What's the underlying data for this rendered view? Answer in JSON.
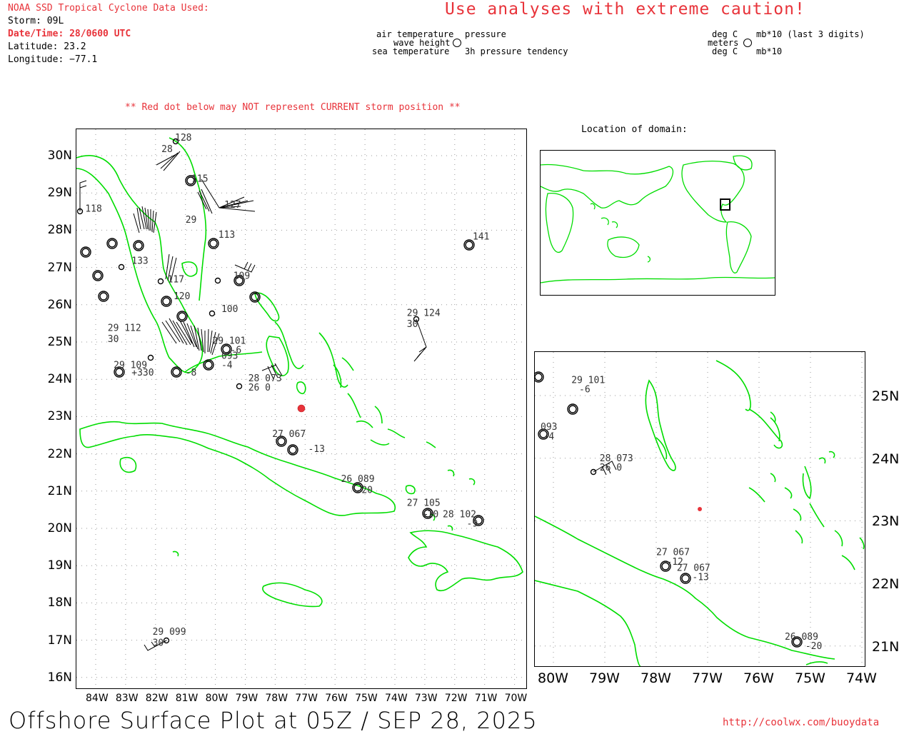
{
  "header": {
    "source": "NOAA SSD Tropical Cyclone Data Used:",
    "storm": "Storm: 09L",
    "datetime": "Date/Time: 28/0600 UTC",
    "latitude": "Latitude: 23.2",
    "longitude": "Longitude: −77.1",
    "caution": "Use analyses with extreme caution!",
    "red_dot_note": "** Red dot below may NOT represent CURRENT storm position **"
  },
  "legend": {
    "air_temp": "air temperature",
    "pressure": "pressure",
    "wave_height": "wave height",
    "sea_temp": "sea temperature",
    "tendency": "3h pressure tendency",
    "unit_degc": "deg C",
    "unit_mb": "mb*10 (last 3 digits)",
    "unit_meters": "meters",
    "unit_degc2": "deg C",
    "unit_mb10": "mb*10"
  },
  "location_label": "Location of domain:",
  "footer": {
    "title": "Offshore Surface Plot at 05Z / SEP 28, 2025",
    "url": "http://coolwx.com/buoydata"
  },
  "colors": {
    "land": "#00dd00",
    "accent": "#e8333a",
    "grid": "#999999"
  },
  "main_map": {
    "lat_labels": [
      "30N",
      "29N",
      "28N",
      "27N",
      "26N",
      "25N",
      "24N",
      "23N",
      "22N",
      "21N",
      "20N",
      "19N",
      "18N",
      "17N",
      "16N"
    ],
    "lon_labels": [
      "84W",
      "83W",
      "82W",
      "81W",
      "80W",
      "79W",
      "78W",
      "77W",
      "76W",
      "75W",
      "74W",
      "73W",
      "72W",
      "71W",
      "70W"
    ],
    "station_labels": [
      {
        "t": "128",
        "lon": -81.35,
        "lat": 30.4
      },
      {
        "t": "28",
        "lon": -81.8,
        "lat": 30.1
      },
      {
        "t": "115",
        "lon": -80.8,
        "lat": 29.3
      },
      {
        "t": "118",
        "lon": -84.35,
        "lat": 28.5
      },
      {
        "t": "127",
        "lon": -79.7,
        "lat": 28.6
      },
      {
        "t": "29",
        "lon": -81.0,
        "lat": 28.2
      },
      {
        "t": "113",
        "lon": -79.9,
        "lat": 27.8
      },
      {
        "t": "133",
        "lon": -82.8,
        "lat": 27.1
      },
      {
        "t": "117",
        "lon": -81.6,
        "lat": 26.6
      },
      {
        "t": "109",
        "lon": -79.4,
        "lat": 26.7
      },
      {
        "t": "120",
        "lon": -81.4,
        "lat": 26.15
      },
      {
        "t": "100",
        "lon": -79.8,
        "lat": 25.8
      },
      {
        "t": "29 124",
        "lon": -73.6,
        "lat": 25.7
      },
      {
        "t": "30",
        "lon": -73.6,
        "lat": 25.4
      },
      {
        "t": "29 112",
        "lon": -83.6,
        "lat": 25.3
      },
      {
        "t": "30",
        "lon": -83.6,
        "lat": 25.0
      },
      {
        "t": "29 101",
        "lon": -80.1,
        "lat": 24.95
      },
      {
        "t": "-6",
        "lon": -79.5,
        "lat": 24.7
      },
      {
        "t": "093",
        "lon": -79.8,
        "lat": 24.55
      },
      {
        "t": "-4",
        "lon": -79.8,
        "lat": 24.3
      },
      {
        "t": "28 073",
        "lon": -78.9,
        "lat": 23.95
      },
      {
        "t": "26  0",
        "lon": -78.9,
        "lat": 23.7
      },
      {
        "t": "29 109",
        "lon": -83.4,
        "lat": 24.3
      },
      {
        "t": "+330",
        "lon": -82.8,
        "lat": 24.1
      },
      {
        "t": "-8",
        "lon": -81.0,
        "lat": 24.1
      },
      {
        "t": "141",
        "lon": -71.4,
        "lat": 27.75
      },
      {
        "t": "27 067",
        "lon": -78.1,
        "lat": 22.45
      },
      {
        "t": "-13",
        "lon": -76.9,
        "lat": 22.05
      },
      {
        "t": "26 089",
        "lon": -75.8,
        "lat": 21.25
      },
      {
        "t": "-20",
        "lon": -75.3,
        "lat": 20.95
      },
      {
        "t": "27 105",
        "lon": -73.6,
        "lat": 20.6
      },
      {
        "t": "+10",
        "lon": -73.1,
        "lat": 20.3
      },
      {
        "t": "28 102",
        "lon": -72.4,
        "lat": 20.3
      },
      {
        "t": "-9",
        "lon": -71.6,
        "lat": 20.05
      },
      {
        "t": "29 099",
        "lon": -82.1,
        "lat": 17.15
      },
      {
        "t": "30",
        "lon": -82.1,
        "lat": 16.85
      }
    ]
  },
  "inset_map": {
    "lat_labels": [
      "25N",
      "24N",
      "23N",
      "22N",
      "21N"
    ],
    "lon_labels": [
      "80W",
      "79W",
      "78W",
      "77W",
      "76W",
      "75W",
      "74W"
    ],
    "station_labels": [
      {
        "t": "29 101",
        "lon": -79.65,
        "lat": 25.2
      },
      {
        "t": "-6",
        "lon": -79.5,
        "lat": 25.05
      },
      {
        "t": "093",
        "lon": -80.25,
        "lat": 24.45
      },
      {
        "t": "-4",
        "lon": -80.2,
        "lat": 24.3
      },
      {
        "t": "28 073",
        "lon": -79.1,
        "lat": 23.95
      },
      {
        "t": "26  0",
        "lon": -79.1,
        "lat": 23.8
      },
      {
        "t": "27 067",
        "lon": -78.0,
        "lat": 22.45
      },
      {
        "t": "-12",
        "lon": -77.8,
        "lat": 22.3
      },
      {
        "t": "27 067",
        "lon": -77.6,
        "lat": 22.2
      },
      {
        "t": "-13",
        "lon": -77.3,
        "lat": 22.05
      },
      {
        "t": "26 089",
        "lon": -75.5,
        "lat": 21.1
      },
      {
        "t": "-20",
        "lon": -75.1,
        "lat": 20.95
      }
    ]
  }
}
